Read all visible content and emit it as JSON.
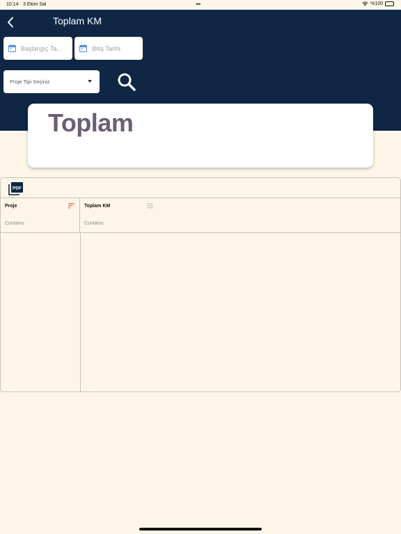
{
  "status_bar": {
    "time": "10:14",
    "date": "3 Ekim Sal",
    "battery": "%100"
  },
  "header": {
    "title": "Toplam KM",
    "background_color": "#0f2645"
  },
  "filters": {
    "start_date_placeholder": "Başlangıç Ta...",
    "end_date_placeholder": "Bitiş Tarihi",
    "project_type_placeholder": "Proje Tipi Seçiniz",
    "calendar_icon_color": "#4a90e2"
  },
  "total_card": {
    "title": "Toplam",
    "title_color": "#6a5f74"
  },
  "grid": {
    "columns": [
      {
        "header": "Proje",
        "filter_placeholder": "Contains",
        "sort_icon": "sort-lines-red"
      },
      {
        "header": "Toplam KM",
        "filter_placeholder": "Contains",
        "sort_icon": "sort-lines-grey"
      }
    ],
    "rows": []
  }
}
